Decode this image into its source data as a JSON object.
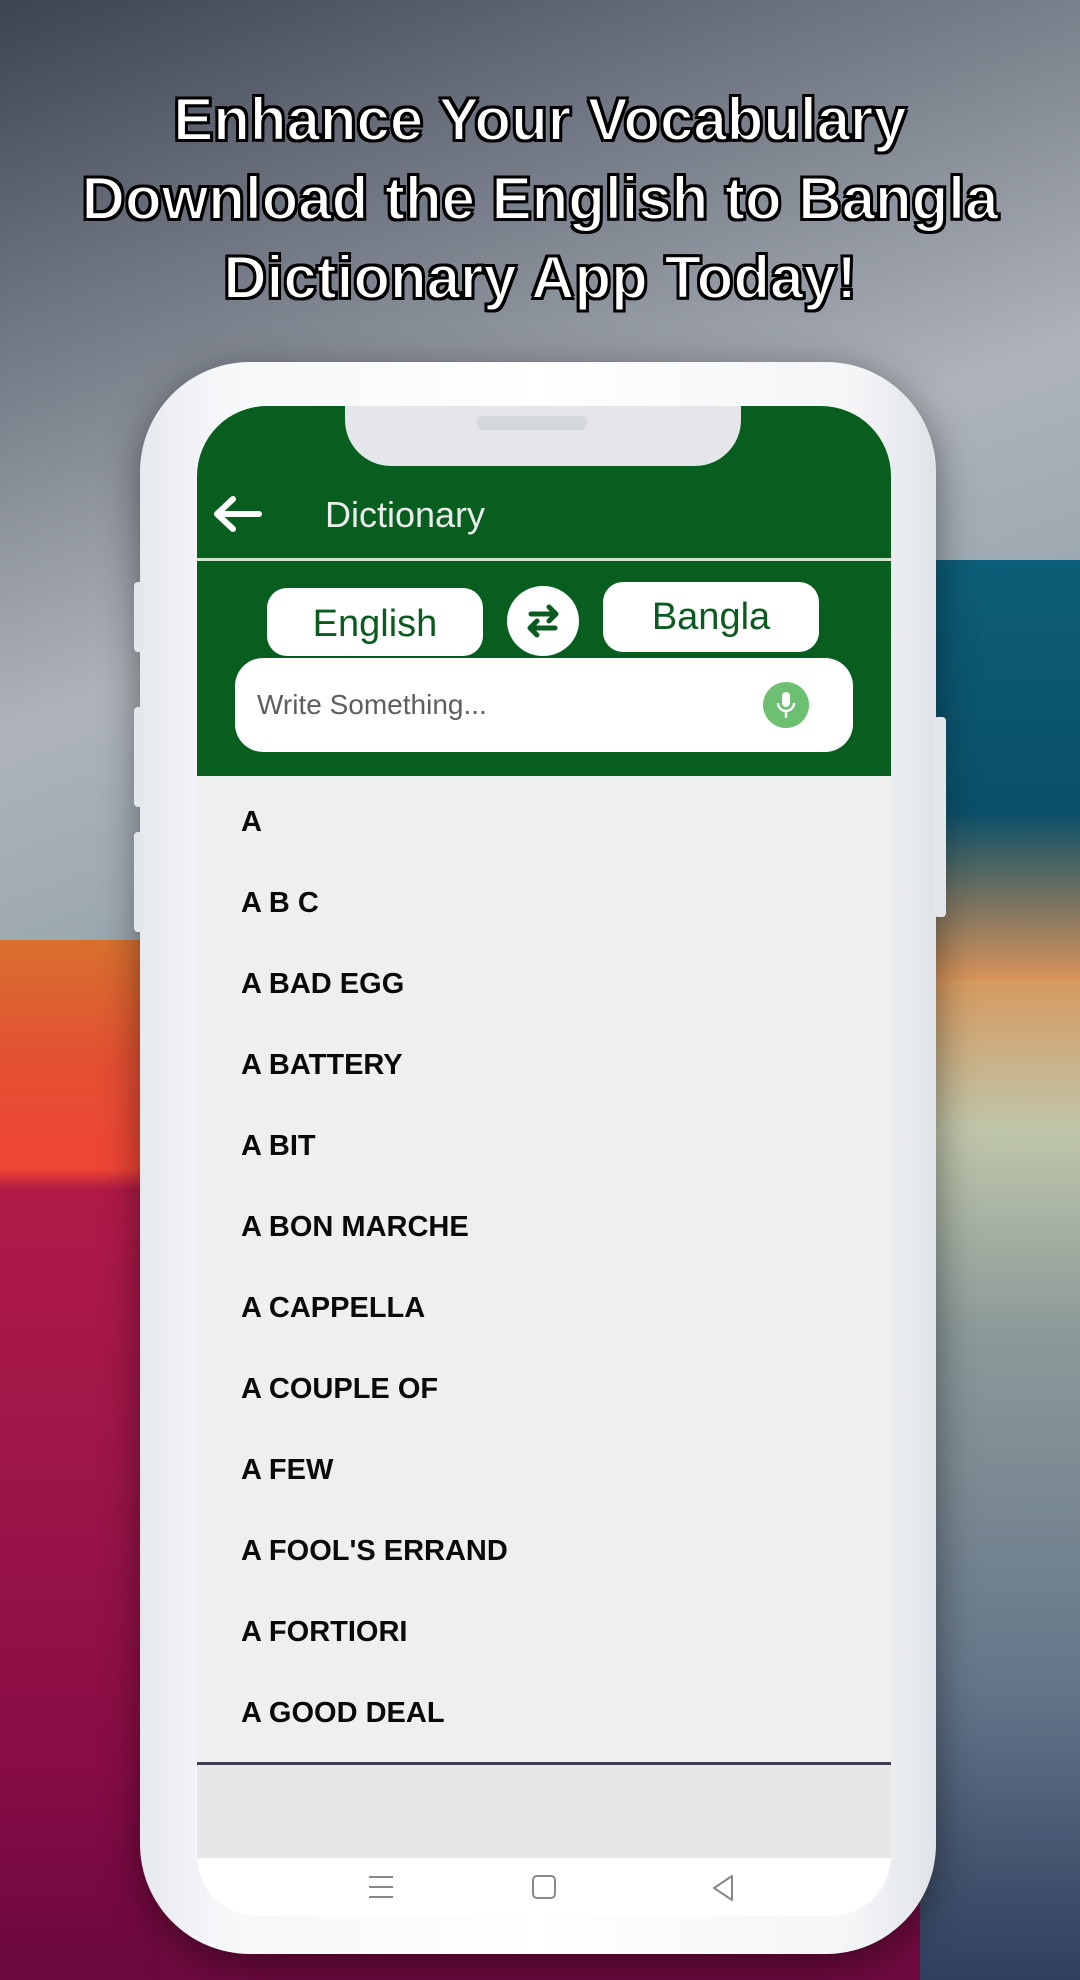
{
  "headline": {
    "line1": "Enhance Your Vocabulary",
    "line2": "Download the English to Bangla",
    "line3": "Dictionary App Today!"
  },
  "app": {
    "title": "Dictionary",
    "back_icon": "arrow-left-icon",
    "theme_color": "#075E1F",
    "mic_color": "#6DBF72"
  },
  "languages": {
    "source": "English",
    "target": "Bangla",
    "swap_icon": "swap-arrows-icon"
  },
  "search": {
    "placeholder": "Write Something...",
    "value": "",
    "mic_icon": "microphone-icon"
  },
  "words": [
    "A",
    "A B C",
    "A BAD EGG",
    "A BATTERY",
    "A BIT",
    "A BON MARCHE",
    "A CAPPELLA",
    "A COUPLE OF",
    "A FEW",
    "A FOOL'S ERRAND",
    "A FORTIORI",
    "A GOOD DEAL"
  ],
  "navbar": {
    "recents_icon": "recents-icon",
    "home_icon": "home-icon",
    "back_icon": "back-triangle-icon"
  }
}
